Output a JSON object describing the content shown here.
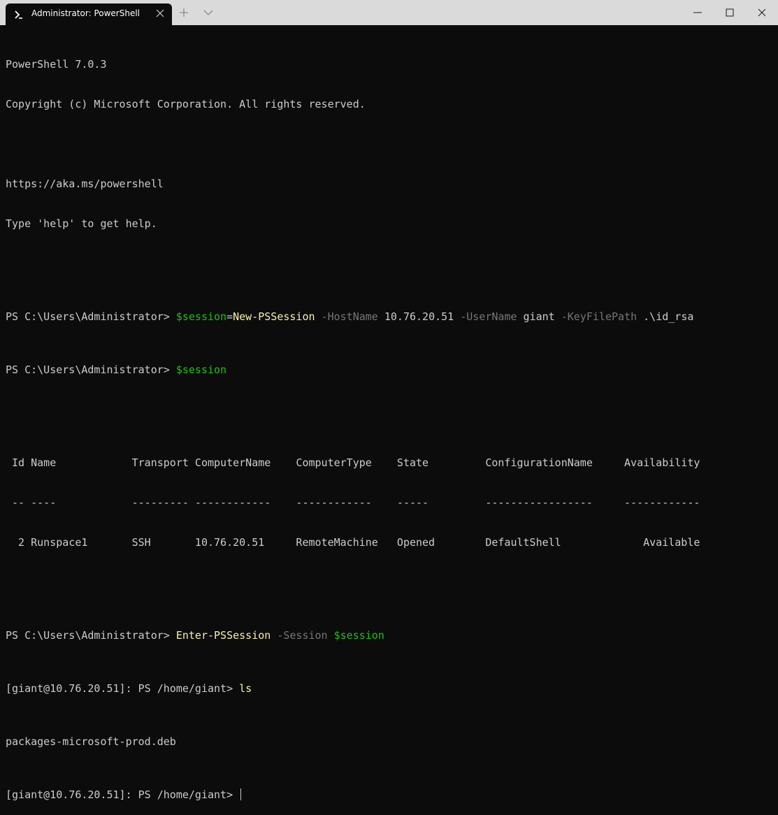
{
  "window": {
    "tab_title": "Administrator: PowerShell",
    "tab_icon": "powershell-icon",
    "new_tab_icon": "plus-icon",
    "dropdown_icon": "chevron-down-icon",
    "controls": [
      "minimize-icon",
      "maximize-icon",
      "close-icon"
    ]
  },
  "colors": {
    "background": "#0c0c0c",
    "foreground": "#cccccc",
    "variable": "#16c60c",
    "command": "#f9f1a5",
    "parameter": "#767676",
    "titlebar": "#dadada"
  },
  "terminal": {
    "banner_version": "PowerShell 7.0.3",
    "banner_copyright": "Copyright (c) Microsoft Corporation. All rights reserved.",
    "banner_url": "https://aka.ms/powershell",
    "banner_help": "Type 'help' to get help.",
    "cmd1": {
      "prompt": "PS C:\\Users\\Administrator> ",
      "var": "$session",
      "eq": "=",
      "cmdlet": "New-PSSession",
      "p1": " -HostName",
      "v1": " 10.76.20.51",
      "p2": " -UserName",
      "v2": " giant",
      "p3": " -KeyFilePath",
      "v3": " .\\id_rsa"
    },
    "cmd2": {
      "prompt": "PS C:\\Users\\Administrator> ",
      "var": "$session"
    },
    "table_header": " Id Name            Transport ComputerName    ComputerType    State         ConfigurationName     Availability",
    "table_rule": " -- ----            --------- ------------    ------------    -----         -----------------     ------------",
    "table_row": "  2 Runspace1       SSH       10.76.20.51     RemoteMachine   Opened        DefaultShell             Available",
    "cmd3": {
      "prompt": "PS C:\\Users\\Administrator> ",
      "cmdlet": "Enter-PSSession",
      "p1": " -Session",
      "var": " $session"
    },
    "cmd4": {
      "prompt": "[giant@10.76.20.51]: PS /home/giant> ",
      "cmd": "ls"
    },
    "ls_output": "packages-microsoft-prod.deb",
    "cmd5": {
      "prompt": "[giant@10.76.20.51]: PS /home/giant> "
    }
  }
}
